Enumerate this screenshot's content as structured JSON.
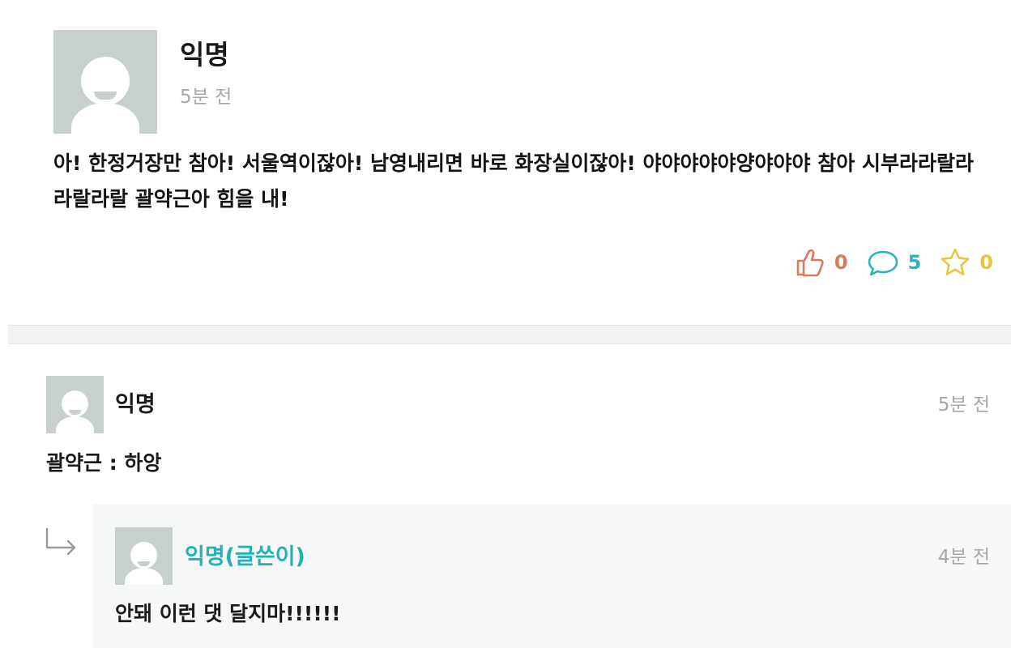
{
  "post": {
    "author": "익명",
    "time": "5분 전",
    "body": "아! 한정거장만 참아! 서울역이잖아! 남영내리면 바로 화장실이잖아! 야야야야야양야야야 참아 시부라라랄라라랄라랄 괄약근아 힘을 내!",
    "actions": {
      "like_icon": "thumbs-up-icon",
      "like_count": "0",
      "comment_icon": "speech-bubble-icon",
      "comment_count": "5",
      "star_icon": "star-icon",
      "star_count": "0"
    }
  },
  "comment": {
    "author": "익명",
    "time": "5분 전",
    "body": "괄약근 : 하앙"
  },
  "reply": {
    "icon": "reply-arrow-icon",
    "author": "익명(글쓴이)",
    "time": "4분 전",
    "body": "안돼 이런 댓 달지마!!!!!!"
  },
  "colors": {
    "like": "#d87a5c",
    "comment": "#2ab3b8",
    "star": "#e6c63f",
    "op_author": "#25b1b3",
    "avatar_bg": "#c7cfcf",
    "muted": "#a7a7a7"
  }
}
